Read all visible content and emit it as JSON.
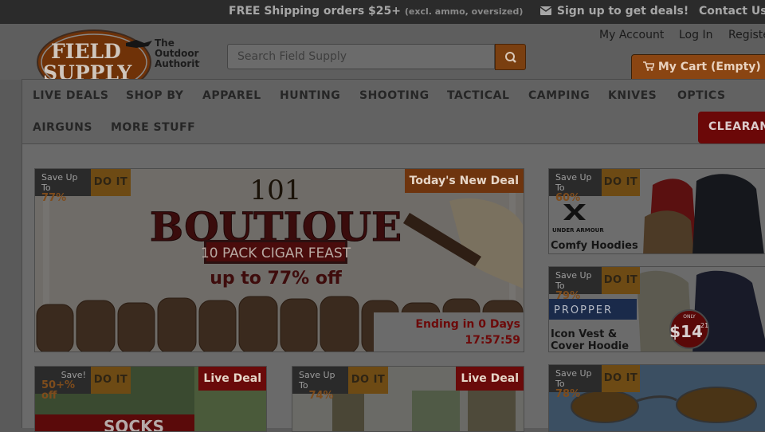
{
  "topbar": {
    "shipping": "FREE Shipping orders $25+",
    "shipping_note": "(excl. ammo, oversized)",
    "signup": "Sign up to get deals!",
    "contact": "Contact Us"
  },
  "logo": {
    "line1": "FIELD",
    "line2": "SUPPLY",
    "tagline1": "The",
    "tagline2": "Outdoor",
    "tagline3": "Authority"
  },
  "account": {
    "my_account": "My Account",
    "login": "Log In",
    "register": "Register"
  },
  "search": {
    "placeholder": "Search Field Supply"
  },
  "cart": {
    "label": "My Cart (Empty)"
  },
  "nav": {
    "items": [
      "LIVE DEALS",
      "SHOP BY",
      "APPAREL",
      "HUNTING",
      "SHOOTING",
      "TACTICAL",
      "CAMPING",
      "KNIVES",
      "OPTICS",
      "AIRGUNS",
      "MORE STUFF"
    ],
    "clearance": "CLEARANCE"
  },
  "featured": {
    "save_label": "Save Up To",
    "save_pct": "77%",
    "doit": "DO IT",
    "badge": "Today's New Deal",
    "title_num": "101",
    "title": "BOUTIQUE",
    "subtitle": "10 PACK CIGAR FEAST",
    "offer": "up to 77% off",
    "ending": "Ending in 0 Days",
    "time": "17:57:59"
  },
  "side_deals": [
    {
      "save_label": "Save Up To",
      "save_pct": "60%",
      "doit": "DO IT",
      "brand": "UNDER ARMOUR",
      "caption": "Comfy Hoodies"
    },
    {
      "save_label": "Save Up To",
      "save_pct": "79%",
      "doit": "DO IT",
      "brand": "PROPPER",
      "caption1": "Icon Vest &",
      "caption2": "Cover Hoodie",
      "price_tag_top": "ONLY",
      "price_tag": "$14",
      "price_tag_cents": "21"
    },
    {
      "save_label": "Save Up To",
      "save_pct": "78%",
      "doit": "DO IT"
    }
  ],
  "bottom_deals": [
    {
      "save_label": "Save!",
      "save_pct": "50+% off",
      "doit": "DO IT",
      "badge": "Live Deal",
      "text": "SOCKS"
    },
    {
      "save_label": "Save Up To",
      "save_pct": "74%",
      "doit": "DO IT",
      "badge": "Live Deal"
    }
  ],
  "colors": {
    "accent_orange": "#e07b26",
    "deal_red": "#c4161c",
    "overlay": "#000000"
  }
}
